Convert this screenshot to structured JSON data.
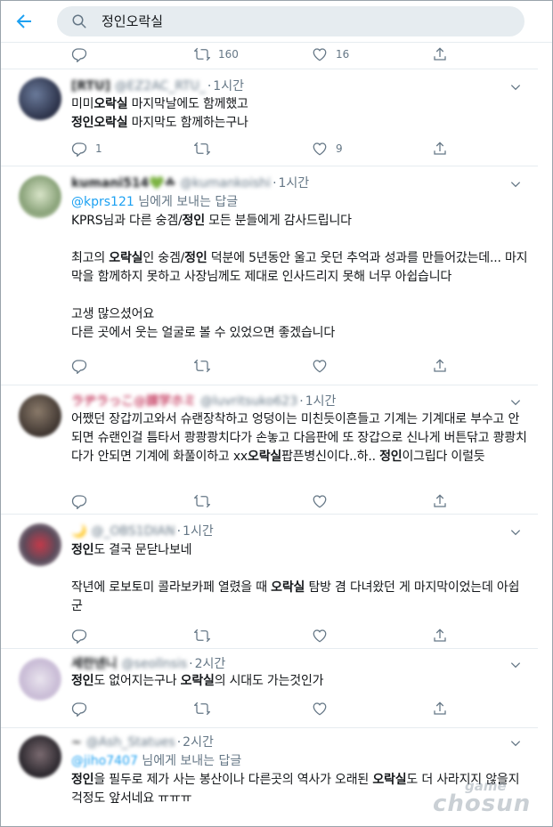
{
  "search": {
    "query": "정인오락실"
  },
  "tweets": [
    {
      "stats": {
        "reply": "",
        "retweet": "160",
        "like": "16"
      }
    },
    {
      "name": "[RTU]",
      "handle": "@EZ2AC_RTU_",
      "time": "1시간",
      "text": "미미오락실 마지막날에도 함께했고\n정인오락실 마지막도 함께하는구나",
      "stats": {
        "reply": "1",
        "retweet": "",
        "like": "9"
      }
    },
    {
      "name": "kumani514💚☘",
      "handle": "@kumankoishi",
      "time": "1시간",
      "reply_prefix": "@kprs121",
      "reply_suffix": " 님에게 보내는 답글",
      "text": "KPRS님과 다른 숭겜/정인 모든 분들에게 감사드립니다\n\n최고의 오락실인 숭겜/정인 덕분에 5년동안 울고 웃던 추억과 성과를 만들어갔는데... 마지막을 함께하지 못하고 사장님께도 제대로 인사드리지 못해 너무 아쉽습니다\n\n고생 많으셨어요\n다른 곳에서 웃는 얼굴로 볼 수 있었으면 좋겠습니다",
      "stats": {
        "reply": "",
        "retweet": "",
        "like": ""
      }
    },
    {
      "name": "ラヂラっこ@課学ホミ",
      "handle": "@luvritsuko623",
      "time": "1시간",
      "text": "어쨌던 장갑끼고와서 슈랜장착하고 엉덩이는 미친듯이흔들고 기계는 기계대로 부수고 안되면 슈랜인걸 틈타서 쾅쾅쾅치다가 손놓고 다음판에 또 장갑으로 신나게 버튼닦고 쾅쾅치다가 안되면 기계에 화풀이하고 xx오락실팝픈병신이다..하.. 정인이그립다 이럴듯",
      "stats": {
        "reply": "",
        "retweet": "",
        "like": ""
      }
    },
    {
      "name": "🌙",
      "handle": "@_OBS1DIAN",
      "time": "1시간",
      "text": "정인도 결국 문닫나보네\n\n작년에 로보토미 콜라보카페 열렸을 때 오락실 탐방 겸 다녀왔던 게 마지막이었는데 아쉽군",
      "stats": {
        "reply": "",
        "retweet": "",
        "like": ""
      }
    },
    {
      "name": "세란넨니",
      "handle": "@seollnsis",
      "time": "2시간",
      "text": "정인도 없어지는구나 오락실의 시대도 가는것인가",
      "stats": {
        "reply": "",
        "retweet": "",
        "like": ""
      }
    },
    {
      "name": "~",
      "handle": "@Ash_Statues",
      "time": "2시간",
      "reply_prefix": "@jiho7407",
      "reply_suffix": " 님에게 보내는 답글",
      "text": "정인을 필두로 제가 사는 봉산이나 다른곳의 역사가 오래된 오락실도 더 사라지지 않을지 걱정도 앞서네요 ㅠㅠㅠ",
      "stats": {
        "reply": "",
        "retweet": "",
        "like": ""
      }
    }
  ],
  "watermark": {
    "line1": "game",
    "line2": "chosun"
  },
  "colors": {
    "accent": "#1da1f2",
    "secondary_text": "#657786",
    "divider": "#e6ecf0",
    "search_bg": "#e6ecf0"
  },
  "icons": [
    "back-arrow-icon",
    "search-icon",
    "reply-icon",
    "retweet-icon",
    "like-icon",
    "share-icon",
    "chevron-down-icon"
  ]
}
